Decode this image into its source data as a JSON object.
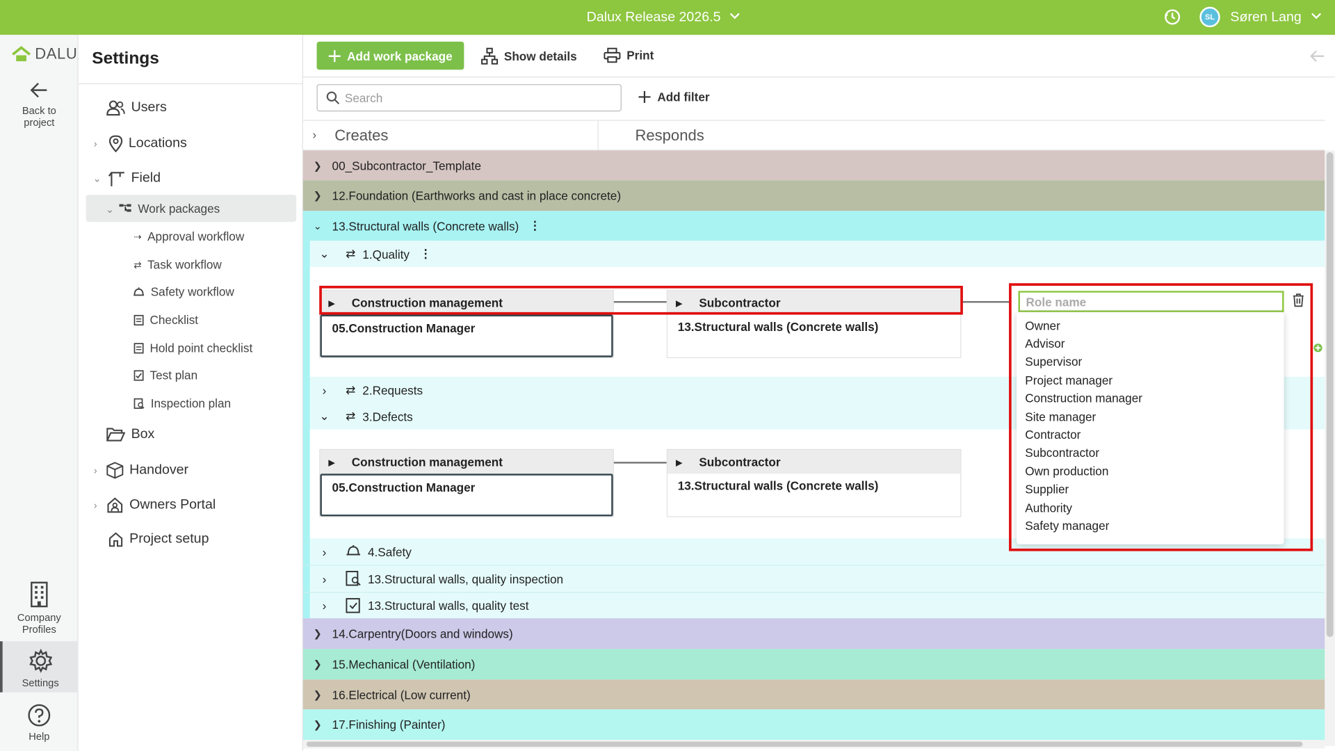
{
  "topbar": {
    "release": "Dalux Release 2026.5",
    "user_initials": "SL",
    "user_name": "Søren Lang",
    "bg_color": "#8dc63f"
  },
  "rail": {
    "logo": "DALUX",
    "back_label_1": "Back to",
    "back_label_2": "project",
    "company_label_1": "Company",
    "company_label_2": "Profiles",
    "settings_label": "Settings",
    "help_label": "Help"
  },
  "settings": {
    "title": "Settings",
    "items": {
      "users": "Users",
      "locations": "Locations",
      "field": "Field",
      "work_packages": "Work packages",
      "approval_workflow": "Approval workflow",
      "task_workflow": "Task workflow",
      "safety_workflow": "Safety workflow",
      "checklist": "Checklist",
      "hold_point_checklist": "Hold point checklist",
      "test_plan": "Test plan",
      "inspection_plan": "Inspection plan",
      "box": "Box",
      "handover": "Handover",
      "owners_portal": "Owners Portal",
      "project_setup": "Project setup"
    }
  },
  "toolbar": {
    "add_work_package": "Add work package",
    "show_details": "Show details",
    "print": "Print",
    "search_placeholder": "Search",
    "add_filter": "Add filter"
  },
  "columns": {
    "creates": "Creates",
    "responds": "Responds"
  },
  "packages": {
    "p00": "00_Subcontractor_Template",
    "p12": "12.Foundation (Earthworks and cast in place concrete)",
    "p13": "13.Structural walls (Concrete walls)",
    "p14": "14.Carpentry(Doors and windows)",
    "p15": "15.Mechanical (Ventilation)",
    "p16": "16.Electrical (Low current)",
    "p17": "17.Finishing (Painter)"
  },
  "subitems": {
    "quality": "1.Quality",
    "requests": "2.Requests",
    "defects": "3.Defects",
    "safety": "4.Safety",
    "inspection": "13.Structural walls, quality inspection",
    "test": "13.Structural walls, quality test"
  },
  "workflow": {
    "creator_role": "Construction management",
    "creator_company": "05.Construction Manager",
    "responder_role": "Subcontractor",
    "responder_company": "13.Structural walls (Concrete walls)"
  },
  "role_input": {
    "placeholder": "Role name"
  },
  "role_options": [
    "Owner",
    "Advisor",
    "Supervisor",
    "Project manager",
    "Construction manager",
    "Site manager",
    "Contractor",
    "Subcontractor",
    "Own production",
    "Supplier",
    "Authority",
    "Safety manager"
  ],
  "colors": {
    "p00": "#d6c6c3",
    "p12": "#b7bea4",
    "p13": "#a9f3f3",
    "p13_sub": "#e5fbfb",
    "p14": "#cdc9e8",
    "p15": "#a7ebd4",
    "p16": "#cfc5b1",
    "p17": "#b4f6f0",
    "highlight": "#e01010"
  }
}
